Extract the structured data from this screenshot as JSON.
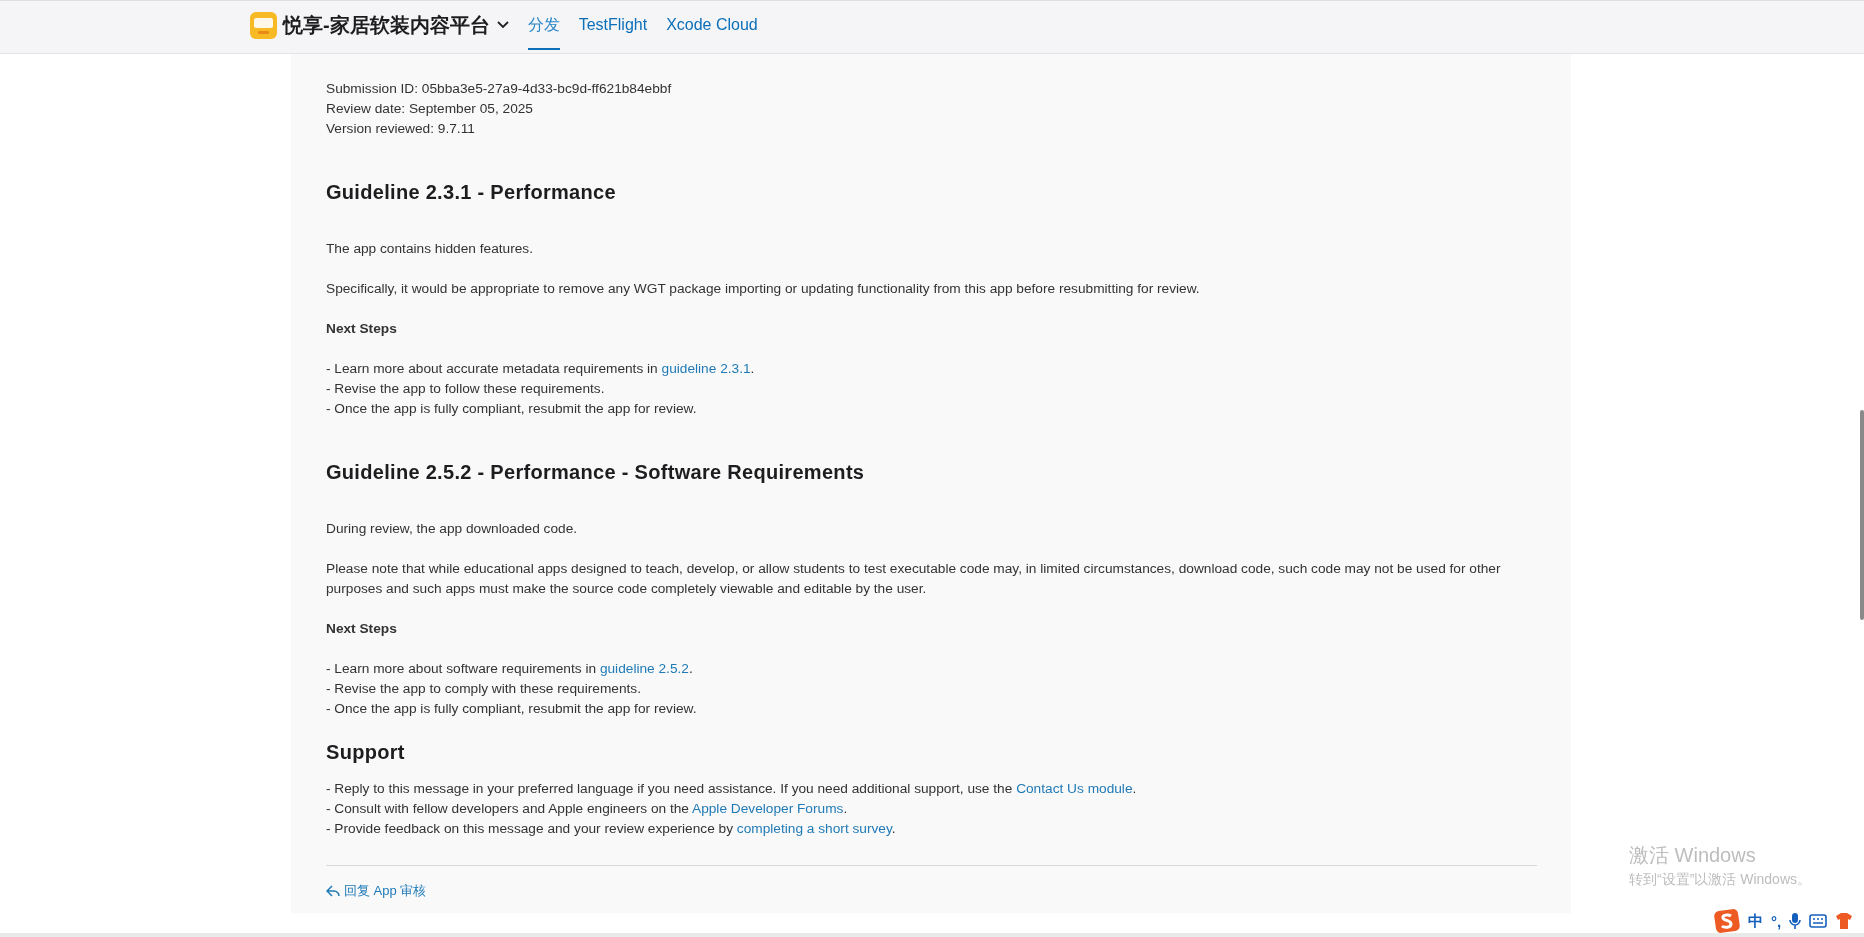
{
  "header": {
    "app_name": "悦享-家居软装内容平台",
    "tabs": [
      {
        "label": "分发",
        "selected": true
      },
      {
        "label": "TestFlight",
        "selected": false
      },
      {
        "label": "Xcode Cloud",
        "selected": false
      }
    ]
  },
  "meta": [
    "Submission ID: 05bba3e5-27a9-4d33-bc9d-ff621b84ebbf",
    "Review date: September 05, 2025",
    "Version reviewed: 9.7.11"
  ],
  "sections": [
    {
      "kind": "guideline",
      "heading": "Guideline 2.3.1 - Performance",
      "blocks": [
        {
          "kind": "text",
          "text": "The app contains hidden features."
        },
        {
          "kind": "text",
          "text": "Specifically, it would be appropriate to remove any WGT package importing or updating functionality from this app before resubmitting for review."
        },
        {
          "kind": "subheading",
          "text": "Next Steps"
        },
        {
          "kind": "list",
          "items": [
            {
              "text": "- Learn more about accurate metadata requirements in ",
              "link": "guideline 2.3.1",
              "after": "."
            },
            {
              "text": "- Revise the app to follow these requirements."
            },
            {
              "text": "- Once the app is fully compliant, resubmit the app for review."
            }
          ]
        }
      ]
    },
    {
      "kind": "guideline",
      "heading": "Guideline 2.5.2 - Performance - Software Requirements",
      "blocks": [
        {
          "kind": "text",
          "text": "During review, the app downloaded code."
        },
        {
          "kind": "text",
          "text": "Please note that while educational apps designed to teach, develop, or allow students to test executable code may, in limited circumstances, download code, such code may not be used for other purposes and such apps must make the source code completely viewable and editable by the user."
        },
        {
          "kind": "subheading",
          "text": "Next Steps"
        },
        {
          "kind": "list",
          "items": [
            {
              "text": "- Learn more about software requirements in ",
              "link": "guideline 2.5.2",
              "after": "."
            },
            {
              "text": "- Revise the app to comply with these requirements."
            },
            {
              "text": "- Once the app is fully compliant, resubmit the app for review."
            }
          ]
        }
      ]
    },
    {
      "kind": "support",
      "heading": "Support",
      "blocks": [
        {
          "kind": "list",
          "items": [
            {
              "text": "- Reply to this message in your preferred language if you need assistance. If you need additional support, use the ",
              "link": "Contact Us module",
              "after": "."
            },
            {
              "text": "- Consult with fellow developers and Apple engineers on the ",
              "link": "Apple Developer Forums",
              "after": "."
            },
            {
              "text": "- Provide feedback on this message and your review experience by ",
              "link": "completing a short survey",
              "after": "."
            }
          ]
        }
      ]
    }
  ],
  "reply_link": "回复 App 审核",
  "activation_notice": {
    "title": "激活 Windows",
    "subtitle": "转到“设置”以激活 Windows。"
  },
  "ime_toolbar": {
    "mode": "中",
    "punctuation": "°,"
  }
}
